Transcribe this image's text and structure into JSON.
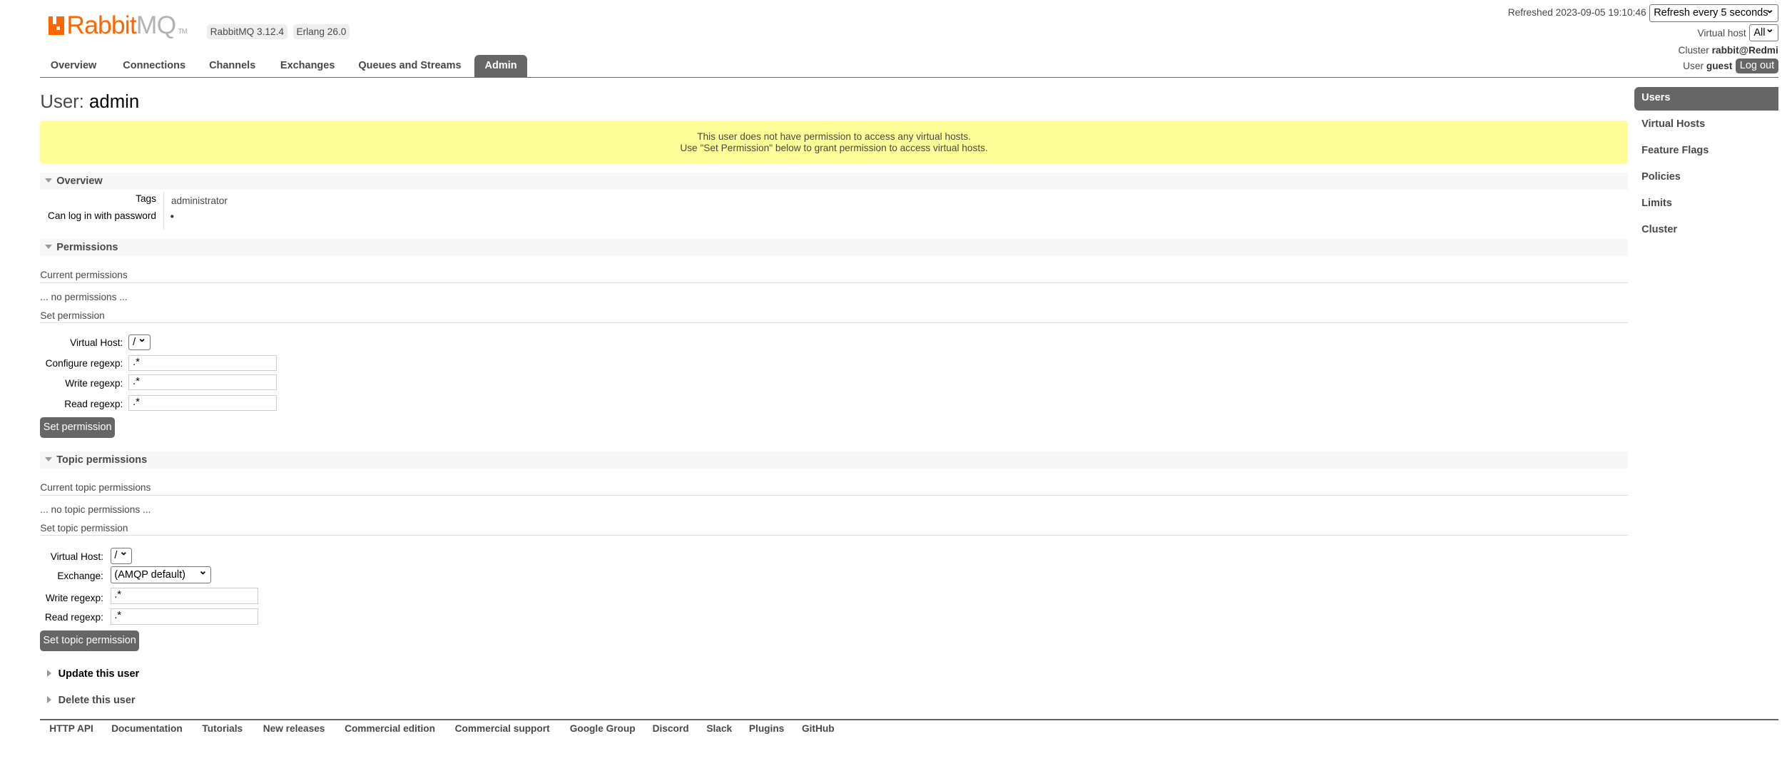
{
  "header": {
    "logo_rabbit": "Rabbit",
    "logo_mq": "MQ",
    "logo_tm": "TM",
    "version": "RabbitMQ 3.12.4",
    "erlang": "Erlang 26.0",
    "refreshed": "Refreshed 2023-09-05 19:10:46",
    "refresh_select": "Refresh every 5 seconds",
    "vhost_label": "Virtual host",
    "vhost_select": "All",
    "cluster_label": "Cluster",
    "cluster_name": "rabbit@Redmi",
    "user_label": "User",
    "user_name": "guest",
    "logout": "Log out"
  },
  "tabs": [
    "Overview",
    "Connections",
    "Channels",
    "Exchanges",
    "Queues and Streams",
    "Admin"
  ],
  "page": {
    "title_prefix": "User:",
    "title_name": "admin",
    "warning_line1": "This user does not have permission to access any virtual hosts.",
    "warning_line2": "Use \"Set Permission\" below to grant permission to access virtual hosts."
  },
  "overview": {
    "heading": "Overview",
    "tags_label": "Tags",
    "tags_value": "administrator",
    "login_label": "Can log in with password",
    "login_value": "●"
  },
  "permissions": {
    "heading": "Permissions",
    "current": "Current permissions",
    "none": "... no permissions ...",
    "set": "Set permission",
    "vhost_label": "Virtual Host:",
    "vhost_value": "/",
    "configure_label": "Configure regexp:",
    "configure_value": ".*",
    "write_label": "Write regexp:",
    "write_value": ".*",
    "read_label": "Read regexp:",
    "read_value": ".*",
    "button": "Set permission"
  },
  "topic": {
    "heading": "Topic permissions",
    "current": "Current topic permissions",
    "none": "... no topic permissions ...",
    "set": "Set topic permission",
    "vhost_label": "Virtual Host:",
    "vhost_value": "/",
    "exchange_label": "Exchange:",
    "exchange_value": "(AMQP default)",
    "write_label": "Write regexp:",
    "write_value": ".*",
    "read_label": "Read regexp:",
    "read_value": ".*",
    "button": "Set topic permission"
  },
  "collapsed": {
    "update": "Update this user",
    "delete": "Delete this user"
  },
  "sidebar": [
    "Users",
    "Virtual Hosts",
    "Feature Flags",
    "Policies",
    "Limits",
    "Cluster"
  ],
  "footer": [
    "HTTP API",
    "Documentation",
    "Tutorials",
    "New releases",
    "Commercial edition",
    "Commercial support",
    "Google Group",
    "Discord",
    "Slack",
    "Plugins",
    "GitHub"
  ]
}
